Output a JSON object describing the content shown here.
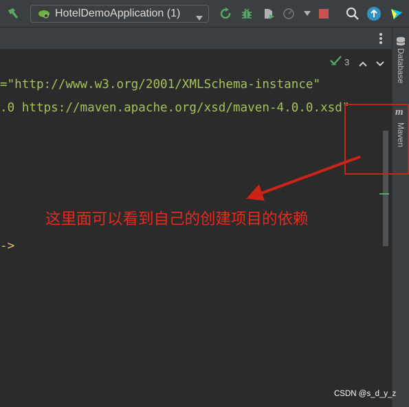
{
  "toolbar": {
    "run_config_label": "HotelDemoApplication (1)",
    "icons": [
      "build-hammer-icon",
      "spring-boot-icon",
      "chevron-down-icon",
      "rerun-icon",
      "debug-bug-icon",
      "coverage-icon",
      "profiler-icon",
      "stop-icon",
      "search-icon",
      "update-icon",
      "jetbrains-logo-icon"
    ]
  },
  "editor": {
    "inspection_count": "3",
    "code_lines": [
      "=\"http://www.w3.org/2001/XMLSchema-instance\"",
      ".0 https://maven.apache.org/xsd/maven-4.0.0.xsd\"",
      "->"
    ]
  },
  "sidebar": {
    "tabs": [
      "Database",
      "Maven"
    ]
  },
  "annotation": {
    "text": "这里面可以看到自己的创建项目的依赖",
    "color": "#e8291c"
  },
  "watermark": "CSDN @s_d_y_z",
  "colors": {
    "code_string": "#a5c25c",
    "background": "#2b2b2b",
    "panel": "#3c3f41"
  }
}
